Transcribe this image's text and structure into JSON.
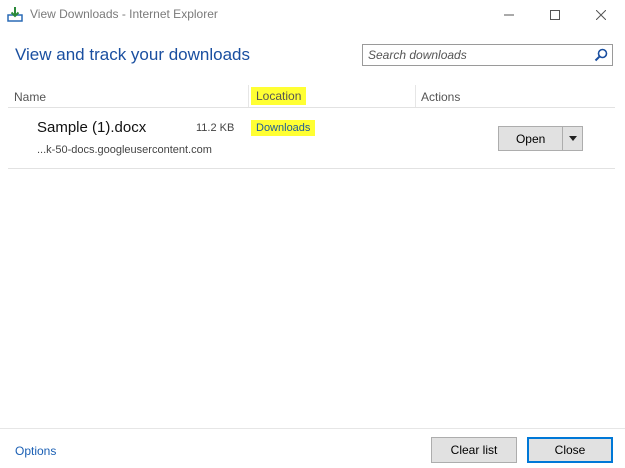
{
  "window": {
    "title": "View Downloads - Internet Explorer",
    "min_glyph": "—",
    "max_glyph": "☐",
    "close_glyph": "✕"
  },
  "header": {
    "heading": "View and track your downloads",
    "search": {
      "placeholder": "Search downloads",
      "value": ""
    }
  },
  "columns": {
    "name": "Name",
    "location": "Location",
    "actions": "Actions"
  },
  "downloads": [
    {
      "name": "Sample (1).docx",
      "size": "11.2 KB",
      "source": "...k-50-docs.googleusercontent.com",
      "location": "Downloads",
      "action": "Open"
    }
  ],
  "footer": {
    "options": "Options",
    "clear_list": "Clear list",
    "close": "Close"
  },
  "colors": {
    "heading": "#1a4fa0",
    "highlight": "#ffff33",
    "link": "#1a5fb4"
  }
}
